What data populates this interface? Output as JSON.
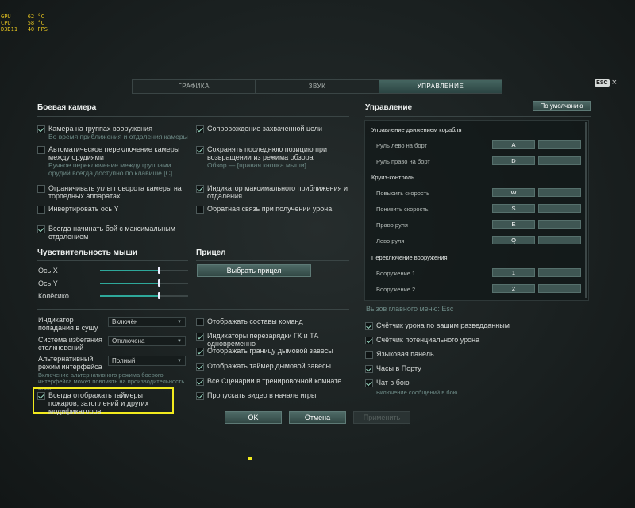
{
  "osd": {
    "text": "GPU     62 °C\nCPU     58 °C\nD3D11   40 FPS"
  },
  "tabs": [
    "ГРАФИКА",
    "ЗВУК",
    "УПРАВЛЕНИЕ"
  ],
  "esc": {
    "key": "ESC",
    "close": "×"
  },
  "camera": {
    "title": "Боевая камера",
    "left": [
      {
        "label": "Камера на группах вооружения",
        "sub": "Во время приближения и отдаления камеры",
        "checked": true
      },
      {
        "label": "Автоматическое переключение камеры между орудиями",
        "sub": "Ручное переключение между группами орудий всегда доступно по клавише [C]",
        "checked": false
      },
      {
        "label": "Ограничивать углы поворота камеры на торпедных аппаратах",
        "checked": false
      },
      {
        "label": "Инвертировать ось Y",
        "checked": false
      },
      {
        "label": "Всегда начинать бой с максимальным отдалением",
        "checked": true
      }
    ],
    "right": [
      {
        "label": "Сопровождение захваченной цели",
        "checked": true
      },
      {
        "label": "Сохранять последнюю позицию при возвращении из режима обзора",
        "sub": "Обзор — [правая кнопка мыши]",
        "checked": true
      },
      {
        "label": "Индикатор максимального приближения и отдаления",
        "checked": true
      },
      {
        "label": "Обратная связь при получении урона",
        "checked": false
      }
    ]
  },
  "mouse": {
    "title": "Чувствительность мыши",
    "axes": [
      {
        "label": "Ось X",
        "value": 0.65
      },
      {
        "label": "Ось Y",
        "value": 0.65
      },
      {
        "label": "Колёсико",
        "value": 0.65
      }
    ]
  },
  "sight": {
    "title": "Прицел",
    "button": "Выбрать прицел"
  },
  "misc": {
    "dropdowns": [
      {
        "label": "Индикатор попадания в сушу",
        "value": "Включён"
      },
      {
        "label": "Система избегания столкновений",
        "value": "Отключена"
      },
      {
        "label": "Альтернативный режим интерфейса",
        "value": "Полный"
      }
    ],
    "alt_note": "Включение альтернативного режима боевого интерфейса может повлиять на производительность игры",
    "highlight": {
      "label": "Всегда отображать таймеры пожаров, затоплений и других модификаторов",
      "checked": true
    },
    "right": [
      {
        "label": "Отображать составы команд",
        "checked": false
      },
      {
        "label": "Индикаторы перезарядки ГК и ТА одновременно",
        "checked": true
      },
      {
        "label": "Отображать границу дымовой завесы",
        "checked": true
      },
      {
        "label": "Отображать таймер дымовой завесы",
        "checked": true
      },
      {
        "label": "Все Сценарии в тренировочной комнате",
        "checked": true
      },
      {
        "label": "Пропускать видео в начале игры",
        "checked": true
      }
    ]
  },
  "controls": {
    "title": "Управление",
    "default_button": "По умолчанию",
    "group1": "Управление движением корабля",
    "a1": "Руль лево на борт",
    "k1": "A",
    "a2": "Руль право на борт",
    "k2": "D",
    "group2": "Круиз-контроль",
    "a3": "Повысить скорость",
    "k3": "W",
    "a4": "Понизить скорость",
    "k4": "S",
    "a5": "Право руля",
    "k5": "E",
    "a6": "Лево руля",
    "k6": "Q",
    "group3": "Переключение вооружения",
    "a7": "Вооружение 1",
    "k7": "1",
    "a8": "Вооружение 2",
    "k8": "2",
    "menu_call": "Вызов главного меню: Esc",
    "checks": [
      {
        "label": "Счётчик урона по вашим разведданным",
        "checked": true
      },
      {
        "label": "Счётчик потенциального урона",
        "checked": true
      },
      {
        "label": "Языковая панель",
        "checked": false
      },
      {
        "label": "Часы в Порту",
        "checked": true
      },
      {
        "label": "Чат в бою",
        "checked": true
      }
    ],
    "chat_note": "Включение сообщений в бою"
  },
  "footer": {
    "ok": "OK",
    "cancel": "Отмена",
    "apply": "Применить"
  }
}
